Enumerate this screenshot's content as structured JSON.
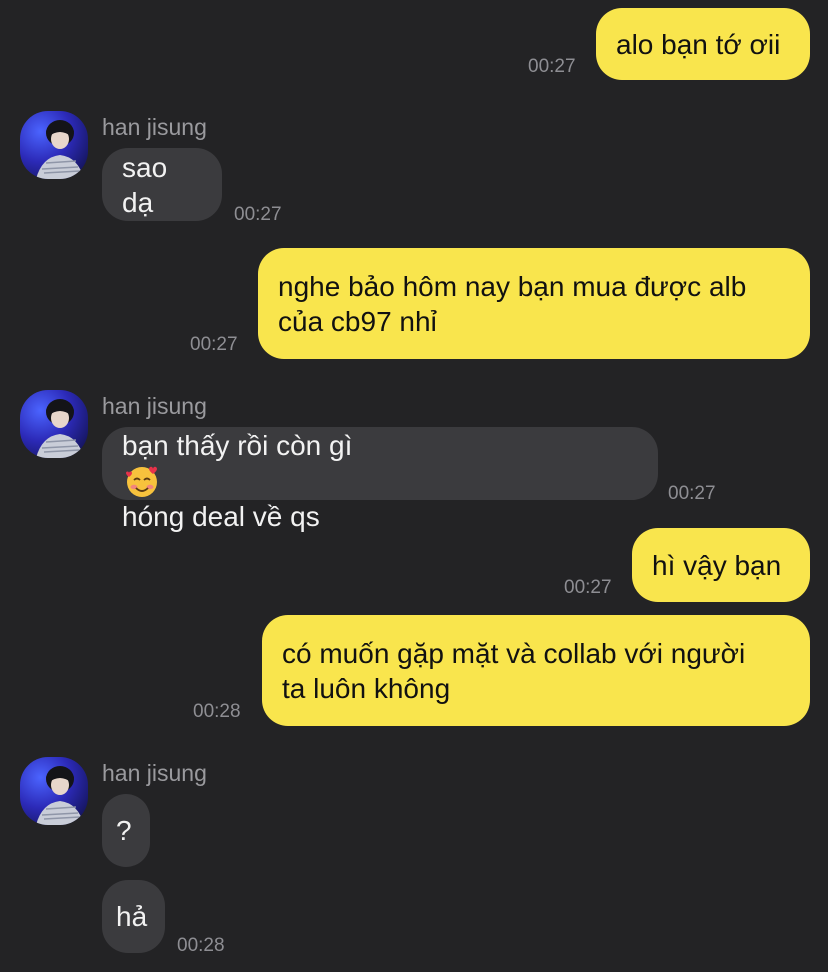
{
  "contact": {
    "name": "han jisung"
  },
  "messages": [
    {
      "id": "m1",
      "direction": "outgoing",
      "text": "alo bạn tớ ơii",
      "time": "00:27"
    },
    {
      "id": "m2",
      "direction": "incoming",
      "sender": "han jisung",
      "text": "sao dạ",
      "time": "00:27"
    },
    {
      "id": "m3",
      "direction": "outgoing",
      "text": "nghe bảo hôm nay bạn mua được alb\ncủa cb97 nhỉ",
      "time": "00:27"
    },
    {
      "id": "m4",
      "direction": "incoming",
      "sender": "han jisung",
      "text_before": "bạn thấy rồi còn gì",
      "emoji": "smiling-face-with-hearts-icon",
      "text_after": "hóng deal về qs",
      "time": "00:27"
    },
    {
      "id": "m5",
      "direction": "outgoing",
      "text": "hì vậy bạn",
      "time": "00:27"
    },
    {
      "id": "m6",
      "direction": "outgoing",
      "text": "có muốn gặp mặt và collab với người\nta luôn không",
      "time": "00:28"
    },
    {
      "id": "m7",
      "direction": "incoming",
      "sender": "han jisung",
      "text": "?"
    },
    {
      "id": "m8",
      "direction": "incoming",
      "text": "hả",
      "time": "00:28"
    }
  ],
  "colors": {
    "background": "#232325",
    "outgoing_bubble": "#f9e54d",
    "incoming_bubble": "#3b3b3e",
    "timestamp": "#8e8e93"
  }
}
